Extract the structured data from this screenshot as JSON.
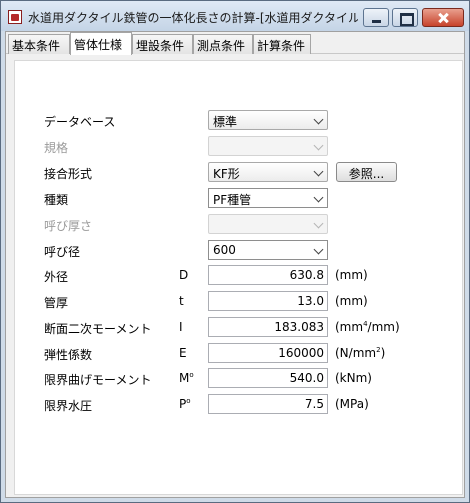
{
  "window": {
    "title": "水道用ダクタイル鉄管の一体化長さの計算-[水道用ダクタイル鉄管..."
  },
  "tabs": [
    "基本条件",
    "管体仕様",
    "埋設条件",
    "測点条件",
    "計算条件"
  ],
  "active_tab": "管体仕様",
  "form": {
    "database": {
      "label": "データベース",
      "value": "標準"
    },
    "standard": {
      "label": "規格",
      "value": ""
    },
    "joint": {
      "label": "接合形式",
      "value": "KF形",
      "button": "参照..."
    },
    "kind": {
      "label": "種類",
      "value": "PF種管"
    },
    "thickness": {
      "label": "呼び厚さ",
      "value": ""
    },
    "nominal": {
      "label": "呼び径",
      "value": "600"
    }
  },
  "params": {
    "outer": {
      "label": "外径",
      "symbol": "D",
      "value": "630.8",
      "unit": "(mm)"
    },
    "wall": {
      "label": "管厚",
      "symbol": "t",
      "value": "13.0",
      "unit": "(mm)"
    },
    "inertia": {
      "label": "断面二次モーメント",
      "symbol": "I",
      "value": "183.083",
      "unit_pre": "(mm",
      "unit_sup": "4",
      "unit_post": "/mm)"
    },
    "modulus": {
      "label": "弾性係数",
      "symbol": "E",
      "value": "160000",
      "unit_pre": "(N/mm",
      "unit_sup": "2",
      "unit_post": ")"
    },
    "moment": {
      "label": "限界曲げモーメント",
      "symbol": "M",
      "symbol_sup": "o",
      "value": "540.0",
      "unit": "(kNm)"
    },
    "pressure": {
      "label": "限界水圧",
      "symbol": "P",
      "symbol_sup": "o",
      "value": "7.5",
      "unit": "(MPa)"
    }
  }
}
